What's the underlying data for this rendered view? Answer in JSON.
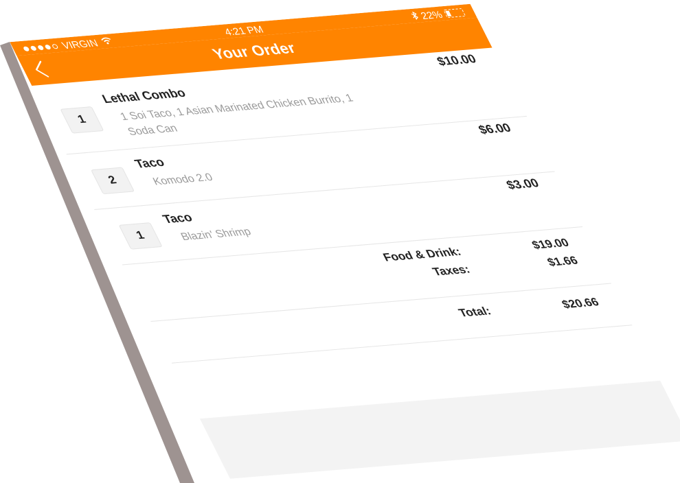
{
  "status_bar": {
    "carrier": "VIRGIN",
    "time": "4:21 PM",
    "battery": "22%",
    "signal_bars": 4,
    "signal_total": 5,
    "icons": [
      "signal-icon",
      "wifi-icon",
      "bluetooth-icon",
      "battery-icon"
    ]
  },
  "nav": {
    "title": "Your Order",
    "back_icon": "chevron-left-icon"
  },
  "order_items": [
    {
      "qty": "1",
      "name": "Lethal Combo",
      "description": "1 Soi Taco, 1 Asian Marinated Chicken Burrito, 1 Soda Can",
      "price": "$10.00"
    },
    {
      "qty": "2",
      "name": "Taco",
      "description": "Komodo 2.0",
      "price": "$6.00"
    },
    {
      "qty": "1",
      "name": "Taco",
      "description": "Blazin' Shrimp",
      "price": "$3.00"
    }
  ],
  "summary": {
    "food_label": "Food & Drink:",
    "food_value": "$19.00",
    "taxes_label": "Taxes:",
    "taxes_value": "$1.66",
    "total_label": "Total:",
    "total_value": "$20.66"
  },
  "colors": {
    "accent": "#ff8400",
    "text": "#222222",
    "muted": "#9a9a9a",
    "phone_edge": "#9e9391"
  }
}
